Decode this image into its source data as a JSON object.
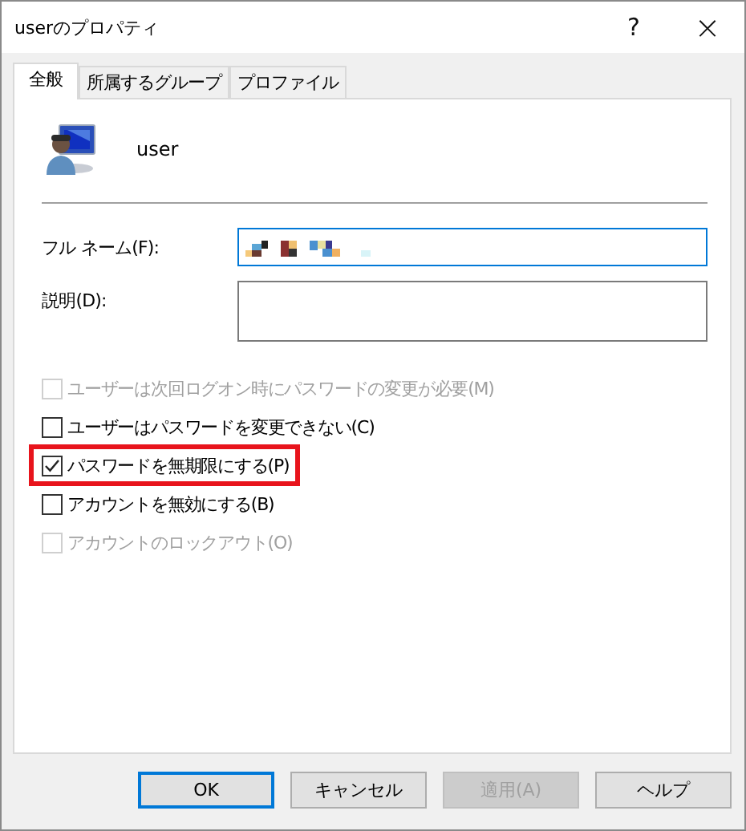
{
  "window": {
    "title": "userのプロパティ",
    "help": "?",
    "close": "×"
  },
  "tabs": [
    {
      "label": "全般",
      "selected": true
    },
    {
      "label": "所属するグループ",
      "selected": false
    },
    {
      "label": "プロファイル",
      "selected": false
    }
  ],
  "user": {
    "name": "user"
  },
  "fields": [
    {
      "label": "フル ネーム(F):",
      "kind": "line",
      "focused": true,
      "redacted": true
    },
    {
      "label": "説明(D):",
      "kind": "area",
      "focused": false,
      "redacted": false
    }
  ],
  "options": [
    {
      "label": "ユーザーは次回ログオン時にパスワードの変更が必要(M)",
      "checked": false,
      "disabled": true,
      "highlighted": false
    },
    {
      "label": "ユーザーはパスワードを変更できない(C)",
      "checked": false,
      "disabled": false,
      "highlighted": false
    },
    {
      "label": "パスワードを無期限にする(P)",
      "checked": true,
      "disabled": false,
      "highlighted": true
    },
    {
      "label": "アカウントを無効にする(B)",
      "checked": false,
      "disabled": false,
      "highlighted": false
    },
    {
      "label": "アカウントのロックアウト(O)",
      "checked": false,
      "disabled": true,
      "highlighted": false
    }
  ],
  "buttons": [
    {
      "label": "OK",
      "default": true,
      "disabled": false
    },
    {
      "label": "キャンセル",
      "default": false,
      "disabled": false
    },
    {
      "label": "適用(A)",
      "default": false,
      "disabled": true
    },
    {
      "label": "ヘルプ",
      "default": false,
      "disabled": false
    }
  ]
}
